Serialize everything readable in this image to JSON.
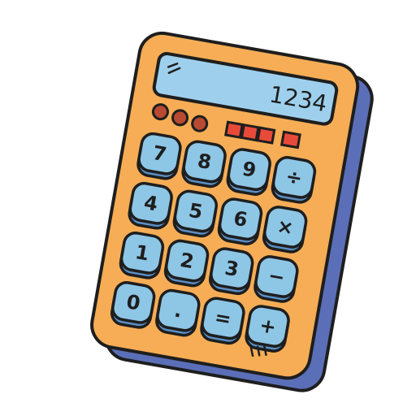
{
  "calculator": {
    "display": {
      "value": "1234"
    },
    "colors": {
      "body": "#f6ad55",
      "side": "#5b6fb8",
      "key": "#8ec6e6",
      "key_shadow": "#5b8fc4",
      "display": "#9ed0ee",
      "round_buttons": "#b84a32",
      "indicators": "#e84a3a",
      "outline": "#1e1e1e"
    },
    "keys": [
      [
        "7",
        "8",
        "9",
        "÷"
      ],
      [
        "4",
        "5",
        "6",
        "×"
      ],
      [
        "1",
        "2",
        "3",
        "−"
      ],
      [
        "0",
        ".",
        "=",
        "+"
      ]
    ],
    "round_buttons": 3,
    "indicator_lights": 4
  }
}
